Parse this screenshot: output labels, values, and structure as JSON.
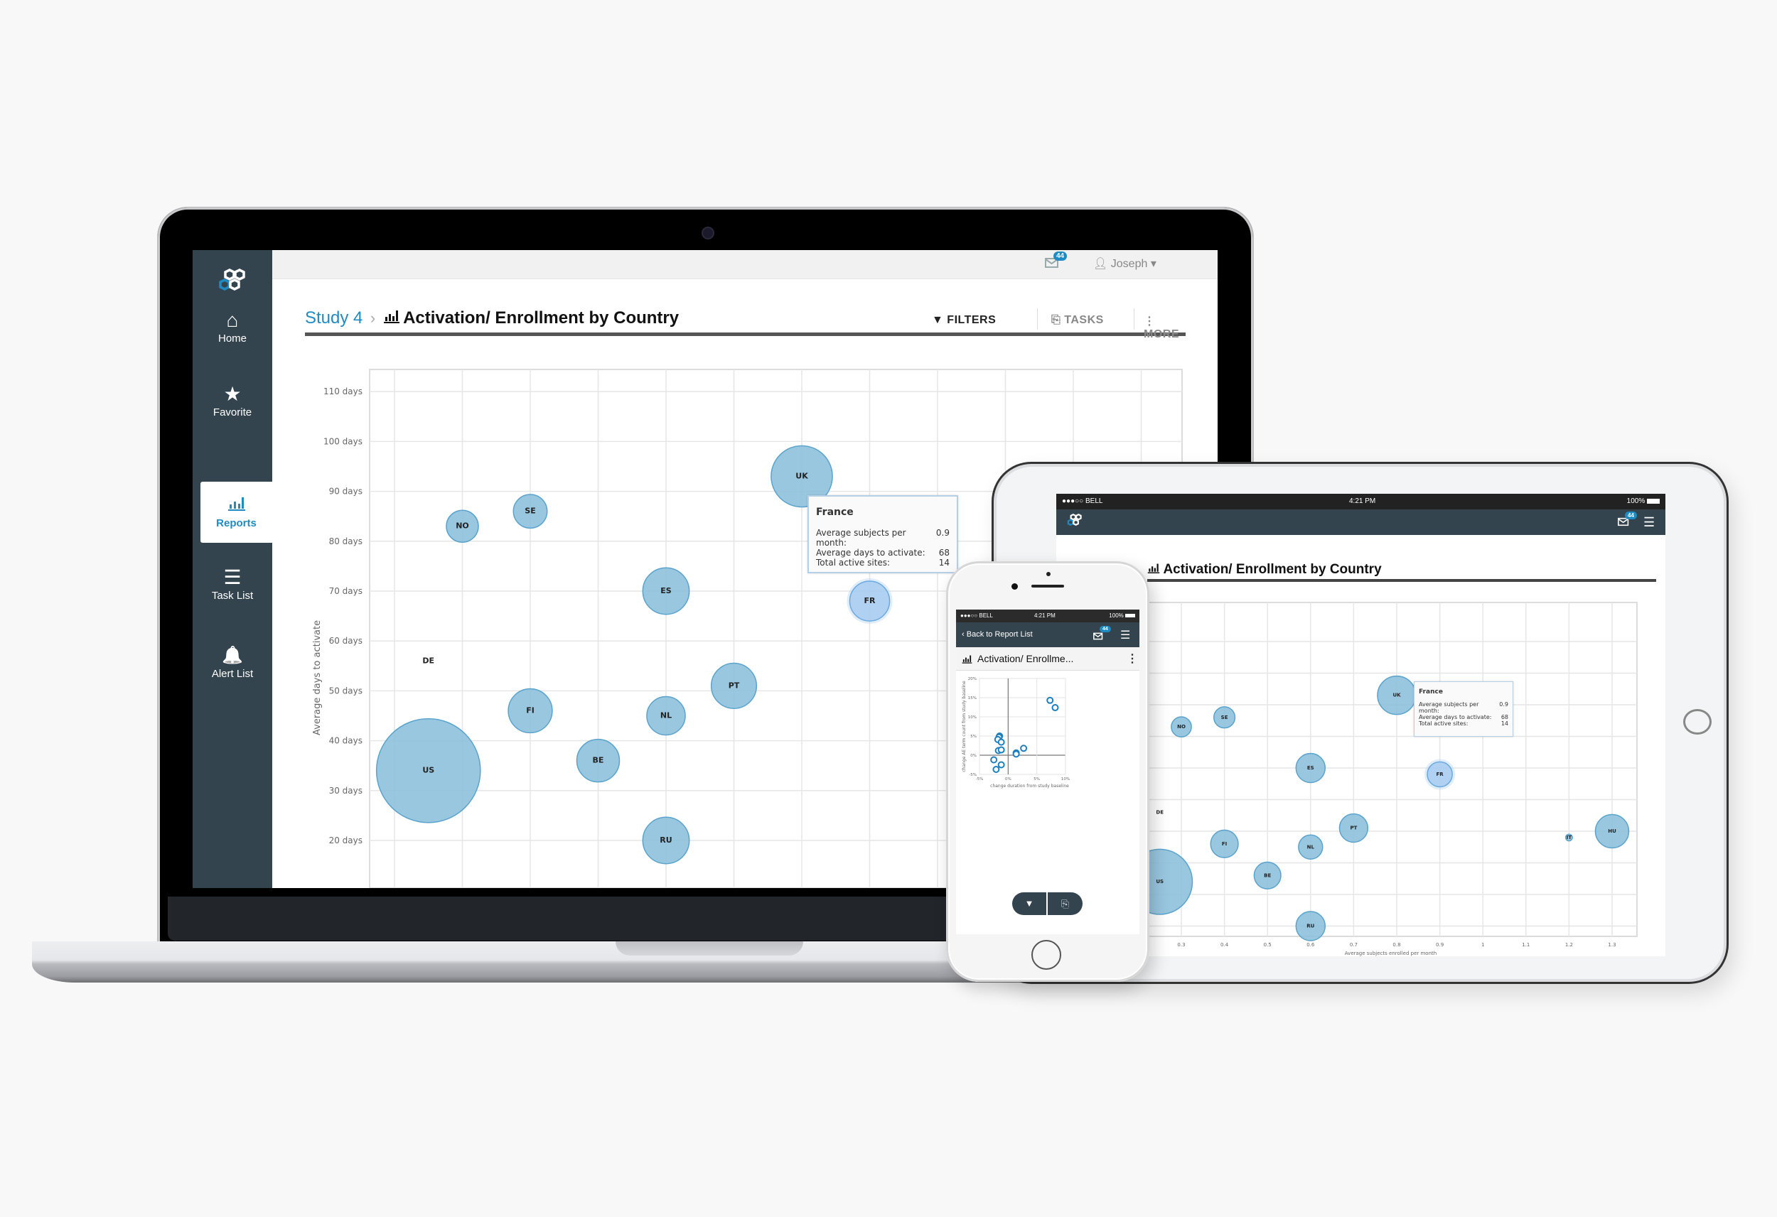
{
  "app": {
    "brand_colors": {
      "accent": "#1e8bc3",
      "sidebar": "#34444f",
      "bubble_fill": "#8bbfdc",
      "bubble_stroke": "#5aa3cc",
      "bubble_highlight": "#a8cdf0"
    }
  },
  "laptop": {
    "sidebar": {
      "items": [
        {
          "label": "Home",
          "icon": "home-icon",
          "glyph": "⌂",
          "active": false
        },
        {
          "label": "Favorite",
          "icon": "star-icon",
          "glyph": "★",
          "active": false
        },
        {
          "label": "Reports",
          "icon": "bar-chart-icon",
          "glyph": "▁▃▅",
          "active": true
        },
        {
          "label": "Task List",
          "icon": "numbered-list-icon",
          "glyph": "☰",
          "active": false
        },
        {
          "label": "Alert List",
          "icon": "bell-check-icon",
          "glyph": "🔔",
          "active": false
        }
      ]
    },
    "topbar": {
      "messages_count": "44",
      "user_name": "Joseph",
      "user_icon": "user-icon",
      "caret": "▾"
    },
    "header": {
      "breadcrumb_parent": "Study 4",
      "breadcrumb_sep": "›",
      "title": "Activation/ Enrollment by Country",
      "actions": [
        {
          "label": "FILTERS",
          "icon": "filter-icon",
          "glyph": "▼"
        },
        {
          "label": "TASKS",
          "icon": "clipboard-icon",
          "glyph": "⎘"
        },
        {
          "label": "MORE",
          "icon": "vertical-dots-icon",
          "glyph": "⋮"
        }
      ]
    },
    "tooltip": {
      "title": "France",
      "rows": [
        {
          "label": "Average subjects per month:",
          "value": "0.9"
        },
        {
          "label": "Average days to activate:",
          "value": "68"
        },
        {
          "label": "Total active sites:",
          "value": "14"
        }
      ]
    }
  },
  "tablet": {
    "status": {
      "carrier": "●●●○○ BELL",
      "time": "4:21 PM",
      "battery": "100%"
    },
    "messages_count": "44",
    "title": "Activation/ Enrollment by Country",
    "tooltip": {
      "title": "France",
      "rows": [
        {
          "label": "Average subjects per month:",
          "value": "0.9"
        },
        {
          "label": "Average days to activate:",
          "value": "68"
        },
        {
          "label": "Total active sites:",
          "value": "14"
        }
      ]
    }
  },
  "phone": {
    "status": {
      "carrier": "●●●○○ BELL",
      "time": "4:21 PM",
      "battery": "100%"
    },
    "back_label": "Back to Report List",
    "messages_count": "44",
    "title": "Activation/ Enrollme...",
    "bottom_buttons": [
      {
        "icon": "filter-icon",
        "glyph": "▼"
      },
      {
        "icon": "clipboard-icon",
        "glyph": "⎘"
      }
    ]
  },
  "chart_data": [
    {
      "type": "scatter",
      "subtype": "bubble",
      "title": "Activation/ Enrollment by Country",
      "xlabel": "Average subjects enrolled per month",
      "ylabel": "Average days to activate",
      "xlim": [
        0.2,
        1.3
      ],
      "ylim": [
        10,
        115
      ],
      "x_ticks": [
        "0.3",
        "0.4",
        "0.5",
        "0.6",
        "0.7",
        "0.8",
        "0.9",
        "1",
        "1.1",
        "1.2",
        "1.3"
      ],
      "y_ticks": [
        "20 days",
        "30 days",
        "40 days",
        "50 days",
        "60 days",
        "70 days",
        "80 days",
        "90 days",
        "100 days",
        "110 days"
      ],
      "y_tick_values": [
        20,
        30,
        40,
        50,
        60,
        70,
        80,
        90,
        100,
        110
      ],
      "grid": true,
      "size_field": "Total active sites",
      "highlighted": "FR",
      "points": [
        {
          "label": "NO",
          "x": 0.3,
          "y": 83,
          "size": 9
        },
        {
          "label": "SE",
          "x": 0.4,
          "y": 86,
          "size": 10
        },
        {
          "label": "UK",
          "x": 0.8,
          "y": 93,
          "size": 33
        },
        {
          "label": "FR",
          "x": 0.9,
          "y": 68,
          "size": 14
        },
        {
          "label": "ES",
          "x": 0.6,
          "y": 70,
          "size": 19
        },
        {
          "label": "DE",
          "x": 0.25,
          "y": 56,
          "size": 0
        },
        {
          "label": "PT",
          "x": 0.7,
          "y": 51,
          "size": 18
        },
        {
          "label": "FI",
          "x": 0.4,
          "y": 46,
          "size": 17
        },
        {
          "label": "NL",
          "x": 0.6,
          "y": 45,
          "size": 13
        },
        {
          "label": "BE",
          "x": 0.5,
          "y": 36,
          "size": 16
        },
        {
          "label": "US",
          "x": 0.25,
          "y": 34,
          "size": 95
        },
        {
          "label": "RU",
          "x": 0.6,
          "y": 20,
          "size": 19
        },
        {
          "label": "IT",
          "x": 1.2,
          "y": 48,
          "size": 1
        },
        {
          "label": "HU",
          "x": 1.3,
          "y": 50,
          "size": 25
        }
      ]
    },
    {
      "type": "scatter",
      "title": "",
      "xlabel": "change duration from study baseline",
      "ylabel": "change AE term count from study baseline",
      "xlim": [
        -5,
        10
      ],
      "ylim": [
        -5,
        20
      ],
      "x_ticks": [
        "-5%",
        "0%",
        "5%",
        "10%"
      ],
      "x_tick_values": [
        -5,
        0,
        5,
        10
      ],
      "y_ticks": [
        "-5%",
        "0%",
        "5%",
        "10%",
        "15%",
        "20%"
      ],
      "y_tick_values": [
        -5,
        0,
        5,
        10,
        15,
        20
      ],
      "grid": true,
      "points": [
        {
          "x": 7.3,
          "y": 14.3
        },
        {
          "x": 8.2,
          "y": 12.4
        },
        {
          "x": -1.5,
          "y": 5.0
        },
        {
          "x": -1.6,
          "y": 4.7
        },
        {
          "x": -1.8,
          "y": 4.1
        },
        {
          "x": -1.2,
          "y": 3.4
        },
        {
          "x": -1.7,
          "y": 1.2
        },
        {
          "x": -1.2,
          "y": 1.4
        },
        {
          "x": -2.5,
          "y": -1.2
        },
        {
          "x": -1.2,
          "y": -2.5
        },
        {
          "x": -2.1,
          "y": -3.7
        },
        {
          "x": 1.4,
          "y": 0.6
        },
        {
          "x": 1.4,
          "y": 0.3
        },
        {
          "x": 2.7,
          "y": 1.8
        }
      ]
    }
  ]
}
